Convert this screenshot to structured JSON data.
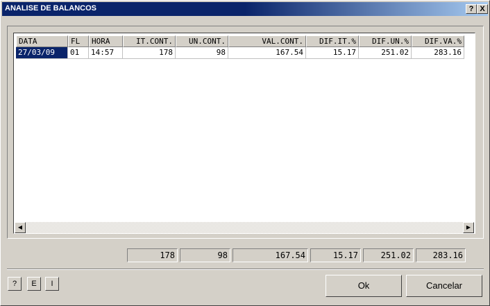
{
  "window": {
    "title": "ANALISE DE BALANCOS",
    "help_btn": "?",
    "close_btn": "X"
  },
  "grid": {
    "columns": [
      "DATA",
      "FL",
      "HORA",
      "IT.CONT.",
      "UN.CONT.",
      "VAL.CONT.",
      "DIF.IT.%",
      "DIF.UN.%",
      "DIF.VA.%"
    ],
    "rows": [
      [
        "27/03/09",
        "01",
        "14:57",
        "178",
        "98",
        "167.54",
        "15.17",
        "251.02",
        "283.16"
      ]
    ]
  },
  "totals": [
    "178",
    "98",
    "167.54",
    "15.17",
    "251.02",
    "283.16"
  ],
  "footer": {
    "help_btn": "?",
    "e_btn": "E",
    "i_btn": "I",
    "ok_btn": "Ok",
    "cancel_btn": "Cancelar"
  }
}
